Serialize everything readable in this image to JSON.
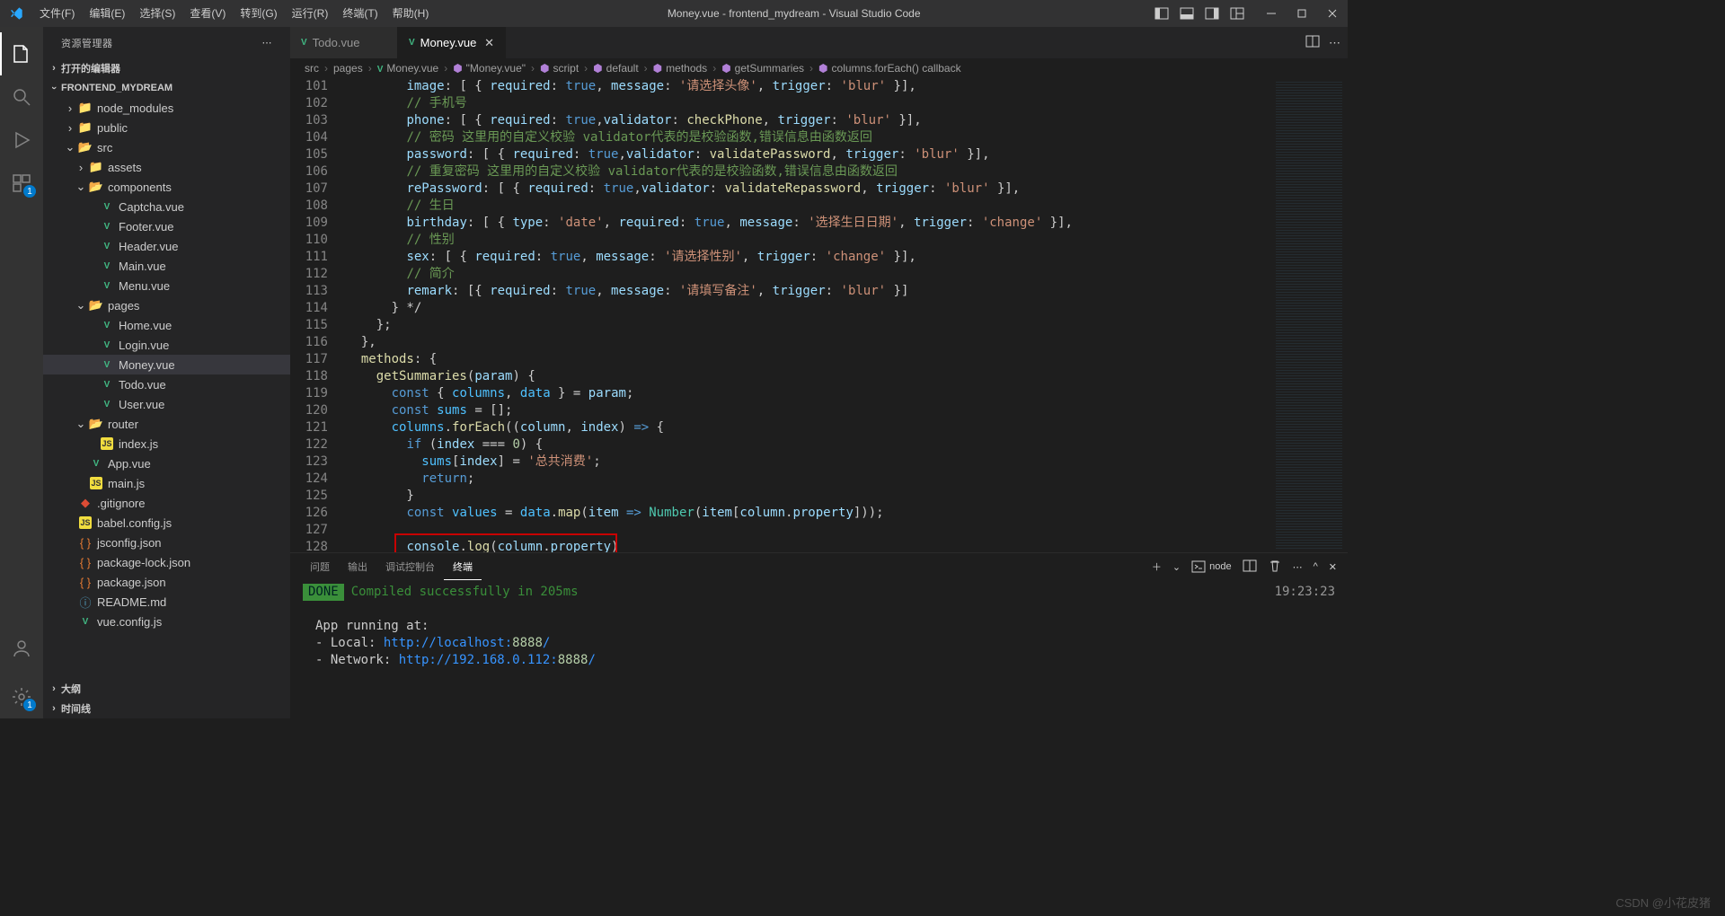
{
  "window": {
    "title": "Money.vue - frontend_mydream - Visual Studio Code"
  },
  "menu": [
    "文件(F)",
    "编辑(E)",
    "选择(S)",
    "查看(V)",
    "转到(G)",
    "运行(R)",
    "终端(T)",
    "帮助(H)"
  ],
  "sidebar": {
    "title": "资源管理器",
    "sections": {
      "open_editors": "打开的编辑器",
      "project": "FRONTEND_MYDREAM",
      "outline": "大纲",
      "timeline": "时间线"
    },
    "tree": [
      {
        "depth": 1,
        "type": "folder-closed",
        "label": "node_modules"
      },
      {
        "depth": 1,
        "type": "folder-closed",
        "label": "public"
      },
      {
        "depth": 1,
        "type": "folder-open",
        "label": "src"
      },
      {
        "depth": 2,
        "type": "folder-closed",
        "label": "assets"
      },
      {
        "depth": 2,
        "type": "folder-open",
        "label": "components"
      },
      {
        "depth": 3,
        "type": "vue",
        "label": "Captcha.vue"
      },
      {
        "depth": 3,
        "type": "vue",
        "label": "Footer.vue"
      },
      {
        "depth": 3,
        "type": "vue",
        "label": "Header.vue"
      },
      {
        "depth": 3,
        "type": "vue",
        "label": "Main.vue"
      },
      {
        "depth": 3,
        "type": "vue",
        "label": "Menu.vue"
      },
      {
        "depth": 2,
        "type": "folder-open",
        "label": "pages"
      },
      {
        "depth": 3,
        "type": "vue",
        "label": "Home.vue"
      },
      {
        "depth": 3,
        "type": "vue",
        "label": "Login.vue"
      },
      {
        "depth": 3,
        "type": "vue",
        "label": "Money.vue",
        "selected": true
      },
      {
        "depth": 3,
        "type": "vue",
        "label": "Todo.vue"
      },
      {
        "depth": 3,
        "type": "vue",
        "label": "User.vue"
      },
      {
        "depth": 2,
        "type": "folder-open",
        "label": "router"
      },
      {
        "depth": 3,
        "type": "js",
        "label": "index.js"
      },
      {
        "depth": 2,
        "type": "vue",
        "label": "App.vue"
      },
      {
        "depth": 2,
        "type": "js",
        "label": "main.js"
      },
      {
        "depth": 1,
        "type": "git",
        "label": ".gitignore"
      },
      {
        "depth": 1,
        "type": "js",
        "label": "babel.config.js"
      },
      {
        "depth": 1,
        "type": "json",
        "label": "jsconfig.json"
      },
      {
        "depth": 1,
        "type": "json",
        "label": "package-lock.json"
      },
      {
        "depth": 1,
        "type": "json",
        "label": "package.json"
      },
      {
        "depth": 1,
        "type": "md",
        "label": "README.md"
      },
      {
        "depth": 1,
        "type": "vue",
        "label": "vue.config.js"
      }
    ]
  },
  "tabs": [
    {
      "label": "Todo.vue",
      "active": false
    },
    {
      "label": "Money.vue",
      "active": true
    }
  ],
  "breadcrumbs": [
    "src",
    "pages",
    "Money.vue",
    "\"Money.vue\"",
    "script",
    "default",
    "methods",
    "getSummaries",
    "columns.forEach() callback"
  ],
  "lineStart": 101,
  "lineCount": 28,
  "code_comments": {
    "c102": "// 手机号",
    "c104": "// 密码 这里用的自定义校验 validator代表的是校验函数,错误信息由函数返回",
    "c106": "// 重复密码 这里用的自定义校验 validator代表的是校验函数,错误信息由函数返回",
    "c108": "// 生日",
    "c110": "// 性别",
    "c112": "// 简介"
  },
  "code_strings": {
    "s101": "'请选择头像'",
    "blur": "'blur'",
    "change": "'change'",
    "s109": "'选择生日日期'",
    "s111": "'请选择性别'",
    "s113": "'请填写备注'",
    "s123": "'总共消费'"
  },
  "panel": {
    "tabs": [
      "问题",
      "输出",
      "调试控制台",
      "终端"
    ],
    "active": 3,
    "node_label": "node",
    "done": "DONE",
    "compiled": "Compiled successfully in 205ms",
    "app_running": "App running at:",
    "local_label": "- Local:   ",
    "local_url_prefix": "http://localhost:",
    "local_port": "8888",
    "net_label": "- Network: ",
    "net_url_prefix": "http://192.168.0.112:",
    "net_port": "8888",
    "clock": "19:23:23"
  },
  "watermark": "CSDN @小花皮猪"
}
